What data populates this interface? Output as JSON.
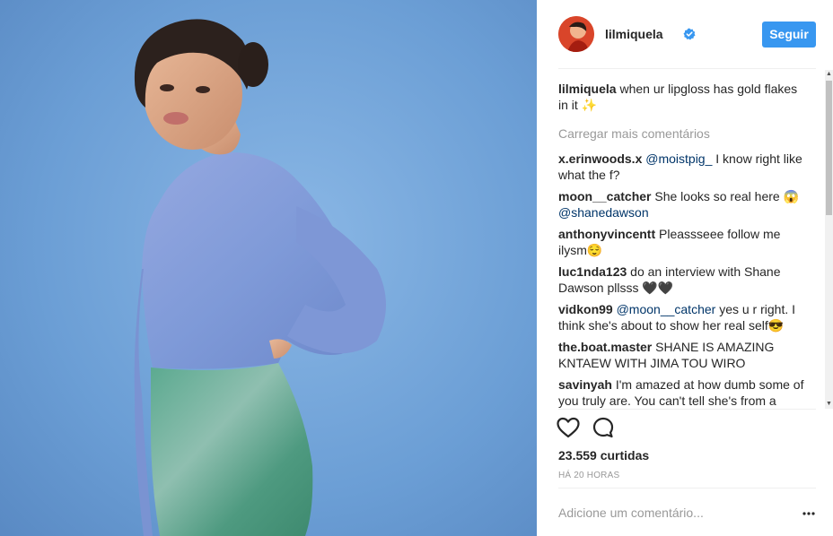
{
  "post": {
    "username": "lilmiquela",
    "follow_label": "Seguir",
    "caption": {
      "user": "lilmiquela",
      "text": "when ur lipgloss has gold flakes in it ✨"
    },
    "load_more_label": "Carregar mais comentários",
    "comments": [
      {
        "user": "x.erinwoods.x",
        "mention": "@moistpig_",
        "text": " I know right like what the f?"
      },
      {
        "user": "moon__catcher",
        "text": " She looks so real here 😱 ",
        "mention_after": "@shanedawson"
      },
      {
        "user": "anthonyvincentt",
        "text": " Pleassseee follow me ilysm😌"
      },
      {
        "user": "luc1nda123",
        "text": " do an interview with Shane Dawson pllsss 🖤🖤"
      },
      {
        "user": "vidkon99",
        "mention": "@moon__catcher",
        "text": " yes u r right. I think she's about to show her real self😎"
      },
      {
        "user": "the.boat.master",
        "text": " SHANE IS AMAZING KNTAEW WITH JIMA TOU WIRO"
      },
      {
        "user": "savinyah",
        "text": " I'm amazed at how dumb some of you truly are. You can't tell she's from a video game? It takes a lot of practice and"
      }
    ],
    "likes": "23.559 curtidas",
    "time_ago": "HÁ 20 HORAS",
    "comment_placeholder": "Adicione um comentário...",
    "colors": {
      "accent": "#3897f0",
      "mention": "#003569",
      "muted": "#999999",
      "wall": "#6a9dd4"
    },
    "icons": [
      "verified-icon",
      "heart-icon",
      "comment-bubble-icon",
      "more-options-icon"
    ]
  }
}
